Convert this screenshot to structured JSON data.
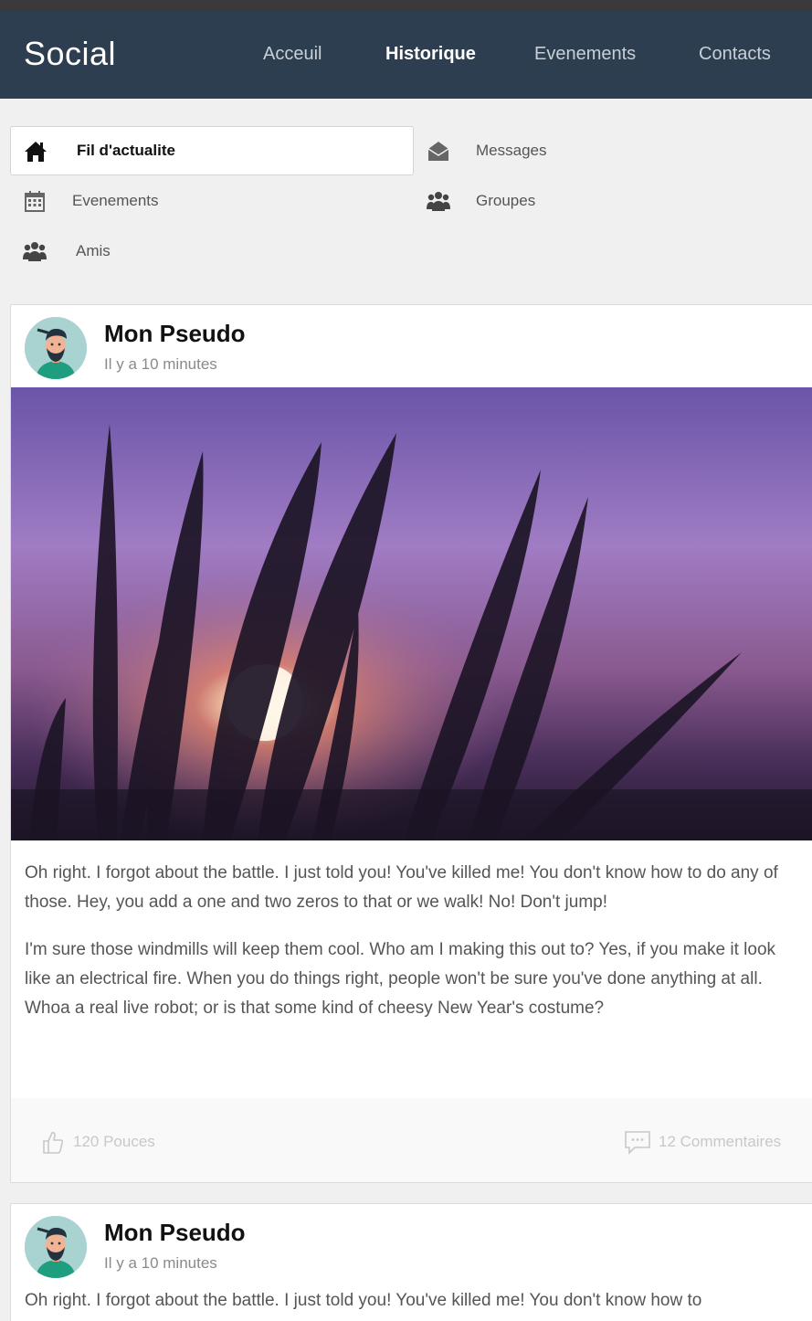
{
  "navbar": {
    "brand": "Social",
    "links": [
      {
        "label": "Acceuil"
      },
      {
        "label": "Historique"
      },
      {
        "label": "Evenements"
      },
      {
        "label": "Contacts"
      }
    ],
    "active": "Historique"
  },
  "menu": {
    "items": [
      {
        "label": "Fil d'actualite",
        "icon": "home-icon"
      },
      {
        "label": "Messages",
        "icon": "envelope-open-icon"
      },
      {
        "label": "Evenements",
        "icon": "calendar-icon"
      },
      {
        "label": "Groupes",
        "icon": "group-icon"
      },
      {
        "label": "Amis",
        "icon": "friends-icon"
      }
    ],
    "active": "Fil d'actualite"
  },
  "posts": [
    {
      "author": "Mon Pseudo",
      "time": "Il y a 10 minutes",
      "paragraphs": [
        "Oh right. I forgot about the battle. I just told you! You've killed me! You don't know how to do any of those. Hey, you add a one and two zeros to that or we walk! No! Don't jump!",
        "I'm sure those windmills will keep them cool. Who am I making this out to? Yes, if you make it look like an electrical fire. When you do things right, people won't be sure you've done anything at all. Whoa a real live robot; or is that some kind of cheesy New Year's costume?"
      ],
      "likes": "120 Pouces",
      "comments": "12 Commentaires"
    },
    {
      "author": "Mon Pseudo",
      "time": "Il y a 10 minutes",
      "paragraphs": [
        "Oh right. I forgot about the battle. I just told you! You've killed me! You don't know how to"
      ]
    }
  ],
  "colors": {
    "navbar": "#2d3e50",
    "topstrip": "#3a3a3a",
    "background": "#f0f0f0",
    "footer_text": "#c8c8c8"
  }
}
